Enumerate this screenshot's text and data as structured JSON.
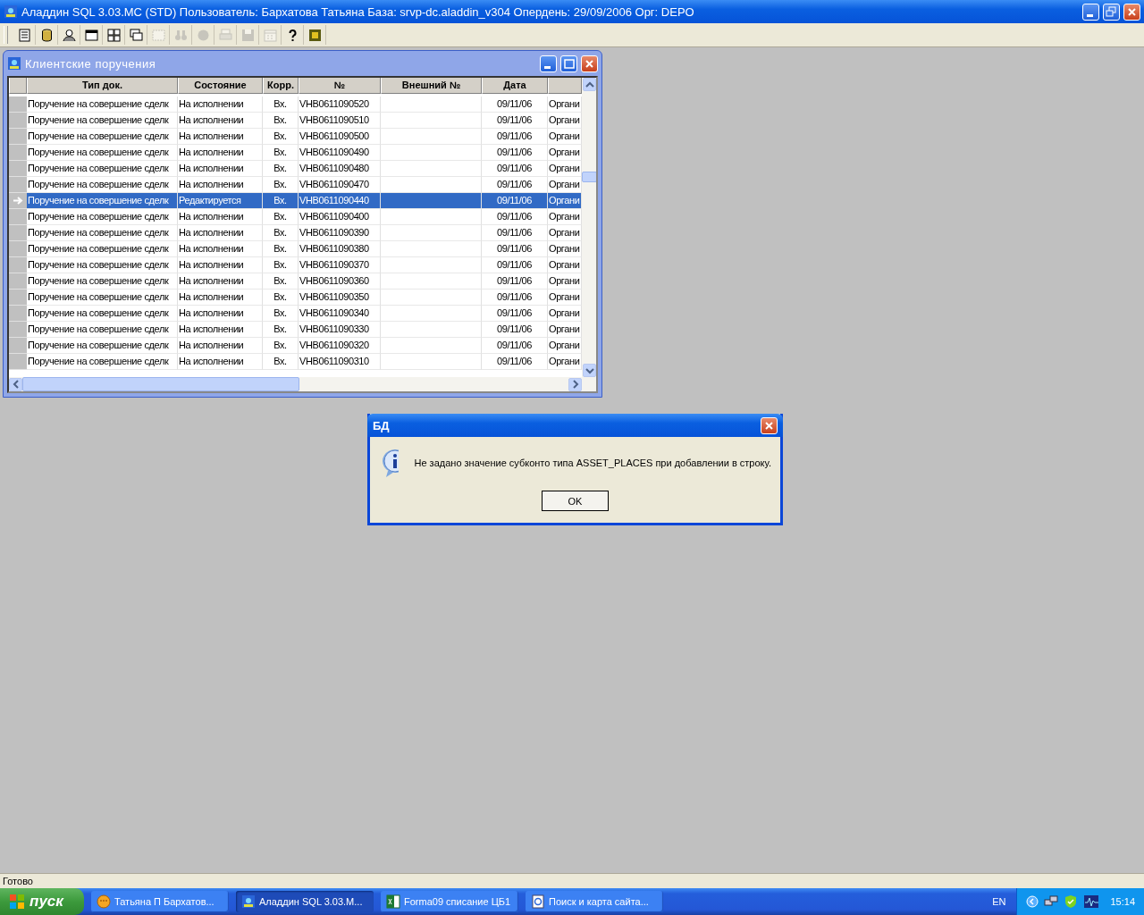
{
  "window": {
    "title": "Аладдин SQL 3.03.МС (STD)  Пользователь: Бархатова Татьяна База: srvp-dc.aladdin_v304 Опердень: 29/09/2006 Орг: DEPO"
  },
  "toolbar": [
    {
      "kind": "document",
      "disabled": false
    },
    {
      "kind": "database",
      "disabled": false
    },
    {
      "kind": "user",
      "disabled": false
    },
    {
      "kind": "window",
      "disabled": false
    },
    {
      "kind": "tile",
      "disabled": false
    },
    {
      "kind": "cascade",
      "disabled": false
    },
    {
      "kind": "frame",
      "disabled": true
    },
    {
      "kind": "binoculars",
      "disabled": true
    },
    {
      "kind": "stop",
      "disabled": true
    },
    {
      "kind": "printer",
      "disabled": true
    },
    {
      "kind": "save",
      "disabled": true
    },
    {
      "kind": "calendar",
      "disabled": true
    },
    {
      "kind": "help",
      "disabled": false
    },
    {
      "kind": "chip",
      "disabled": false
    }
  ],
  "child_window": {
    "title": "Клиентские поручения",
    "table": {
      "columns": [
        "Тип док.",
        "Состояние",
        "Корр.",
        "№",
        "Внешний №",
        "Дата"
      ],
      "rows": [
        {
          "doc_type": "Поручение на совершение сделк",
          "status": "На исполнении",
          "korr": "Вх.",
          "number": "VHB0611090520",
          "date": "09/11/06",
          "column_7": "Органи",
          "selected": false
        },
        {
          "doc_type": "Поручение на совершение сделк",
          "status": "На исполнении",
          "korr": "Вх.",
          "number": "VHB0611090510",
          "date": "09/11/06",
          "column_7": "Органи",
          "selected": false
        },
        {
          "doc_type": "Поручение на совершение сделк",
          "status": "На исполнении",
          "korr": "Вх.",
          "number": "VHB0611090500",
          "date": "09/11/06",
          "column_7": "Органи",
          "selected": false
        },
        {
          "doc_type": "Поручение на совершение сделк",
          "status": "На исполнении",
          "korr": "Вх.",
          "number": "VHB0611090490",
          "date": "09/11/06",
          "column_7": "Органи",
          "selected": false
        },
        {
          "doc_type": "Поручение на совершение сделк",
          "status": "На исполнении",
          "korr": "Вх.",
          "number": "VHB0611090480",
          "date": "09/11/06",
          "column_7": "Органи",
          "selected": false
        },
        {
          "doc_type": "Поручение на совершение сделк",
          "status": "На исполнении",
          "korr": "Вх.",
          "number": "VHB0611090470",
          "date": "09/11/06",
          "column_7": "Органи",
          "selected": false
        },
        {
          "doc_type": "Поручение на совершение сделк",
          "status": "Редактируется",
          "korr": "Вх.",
          "number": "VHB0611090440",
          "date": "09/11/06",
          "column_7": "Органи",
          "selected": true
        },
        {
          "doc_type": "Поручение на совершение сделк",
          "status": "На исполнении",
          "korr": "Вх.",
          "number": "VHB0611090400",
          "date": "09/11/06",
          "column_7": "Органи",
          "selected": false
        },
        {
          "doc_type": "Поручение на совершение сделк",
          "status": "На исполнении",
          "korr": "Вх.",
          "number": "VHB0611090390",
          "date": "09/11/06",
          "column_7": "Органи",
          "selected": false
        },
        {
          "doc_type": "Поручение на совершение сделк",
          "status": "На исполнении",
          "korr": "Вх.",
          "number": "VHB0611090380",
          "date": "09/11/06",
          "column_7": "Органи",
          "selected": false
        },
        {
          "doc_type": "Поручение на совершение сделк",
          "status": "На исполнении",
          "korr": "Вх.",
          "number": "VHB0611090370",
          "date": "09/11/06",
          "column_7": "Органи",
          "selected": false
        },
        {
          "doc_type": "Поручение на совершение сделк",
          "status": "На исполнении",
          "korr": "Вх.",
          "number": "VHB0611090360",
          "date": "09/11/06",
          "column_7": "Органи",
          "selected": false
        },
        {
          "doc_type": "Поручение на совершение сделк",
          "status": "На исполнении",
          "korr": "Вх.",
          "number": "VHB0611090350",
          "date": "09/11/06",
          "column_7": "Органи",
          "selected": false
        },
        {
          "doc_type": "Поручение на совершение сделк",
          "status": "На исполнении",
          "korr": "Вх.",
          "number": "VHB0611090340",
          "date": "09/11/06",
          "column_7": "Органи",
          "selected": false
        },
        {
          "doc_type": "Поручение на совершение сделк",
          "status": "На исполнении",
          "korr": "Вх.",
          "number": "VHB0611090330",
          "date": "09/11/06",
          "column_7": "Органи",
          "selected": false
        },
        {
          "doc_type": "Поручение на совершение сделк",
          "status": "На исполнении",
          "korr": "Вх.",
          "number": "VHB0611090320",
          "date": "09/11/06",
          "column_7": "Органи",
          "selected": false
        },
        {
          "doc_type": "Поручение на совершение сделк",
          "status": "На исполнении",
          "korr": "Вх.",
          "number": "VHB0611090310",
          "date": "09/11/06",
          "column_7": "Органи",
          "selected": false
        }
      ]
    }
  },
  "dialog": {
    "title": "БД",
    "message": "Не задано значение субконто типа ASSET_PLACES при добавлении в строку.",
    "button": "OK"
  },
  "status_bar": {
    "text": "Готово"
  },
  "taskbar": {
    "start": "пуск",
    "tasks": [
      {
        "kind": "messenger",
        "label": "Татьяна П Бархатов...",
        "selected": false
      },
      {
        "kind": "app",
        "label": "Аладдин SQL 3.03.М...",
        "selected": true
      },
      {
        "kind": "spreadsheet",
        "label": "Forma09 списание ЦБ1",
        "selected": false
      },
      {
        "kind": "browser",
        "label": "Поиск и карта сайта...",
        "selected": false
      }
    ],
    "language": "EN",
    "clock": "15:14"
  }
}
